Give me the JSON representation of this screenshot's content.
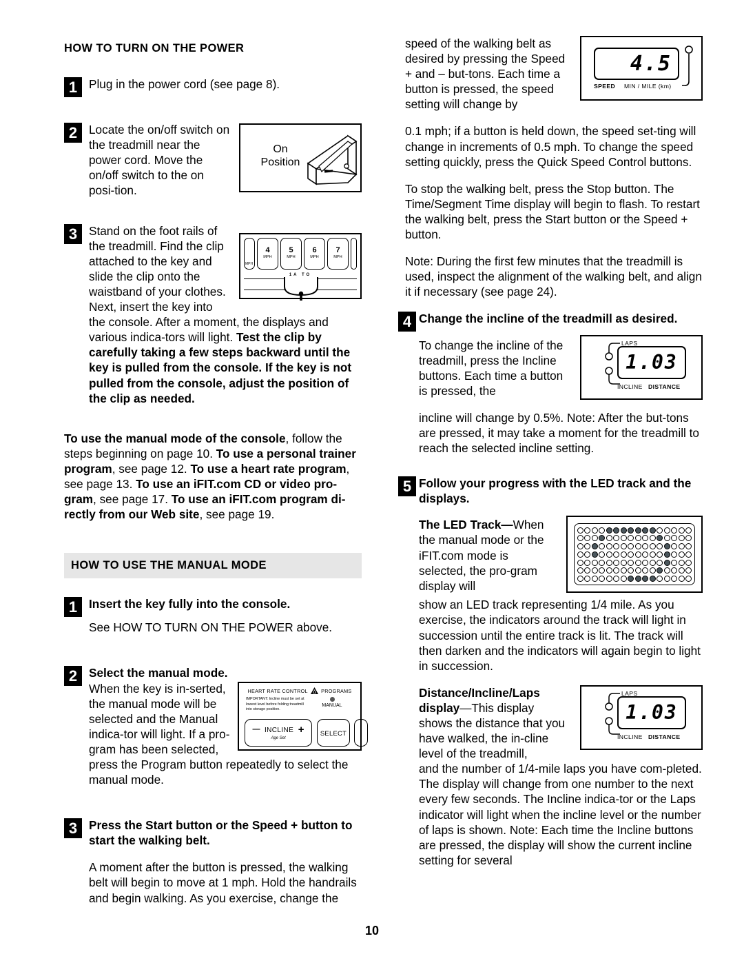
{
  "page": {
    "folio": "10"
  },
  "left": {
    "section1": {
      "heading": "HOW TO TURN ON THE POWER",
      "steps": [
        {
          "num": "1",
          "text": "Plug in the power cord (see page 8)."
        },
        {
          "num": "2",
          "text": "Locate the on/off switch on the treadmill near the power cord. Move the on/off switch to the on posi-tion."
        },
        {
          "num": "3",
          "text_plain": "Stand on the foot rails of the treadmill. Find the clip attached to the key and slide the clip onto the waistband of your clothes. Next, insert the key into the console. After a moment, the displays and various indica-tors will light. ",
          "text_bold": "Test the clip by carefully taking a few steps backward until the key is pulled from the console. If the key is not pulled from the console, adjust the position of the clip as needed."
        }
      ],
      "modes_paragraph": {
        "b1": "To use the manual mode of the console",
        "t1": ", follow the steps beginning on page 10. ",
        "b2": "To use a personal trainer program",
        "t2": ", see page 12. ",
        "b3": "To use a heart rate program",
        "t3": ", see page 13. ",
        "b4": "To use an iFIT.com CD or video pro-gram",
        "t4": ", see page 17. ",
        "b5": "To use an iFIT.com program di-rectly from our Web site",
        "t5": ", see page 19."
      }
    },
    "section2": {
      "heading": "HOW TO USE THE MANUAL MODE",
      "steps": [
        {
          "num": "1",
          "bold": "Insert the key fully into the console.",
          "body": "See HOW TO TURN ON THE POWER above."
        },
        {
          "num": "2",
          "bold": "Select the manual mode.",
          "body": "When the key is in-serted, the manual mode will be selected and the Manual indica-tor will light. If a pro-gram has been selected, press the Program button repeatedly to select the manual mode."
        },
        {
          "num": "3",
          "bold": "Press the Start button or the Speed + button to start the walking belt.",
          "body": "A moment after the button is pressed, the walking belt will begin to move at 1 mph. Hold the handrails and begin walking. As you exercise, change the"
        }
      ]
    },
    "figures": {
      "switch": {
        "label_line1": "On",
        "label_line2": "Position"
      },
      "speed_keys": {
        "keys": [
          {
            "value": "4",
            "unit": "MPH"
          },
          {
            "value": "5",
            "unit": "MPH"
          },
          {
            "value": "6",
            "unit": "MPH"
          },
          {
            "value": "7",
            "unit": "MPH"
          }
        ],
        "marks": "1A  TO"
      },
      "console": {
        "top_label": "HEART RATE CONTROL",
        "top_label2": "PROGRAMS",
        "warning": "IMPORTANT: Incline must be set at lowest level before folding treadmill into storage position.",
        "indicator_label": "MANUAL",
        "incline_minus": "—",
        "incline_label": "INCLINE",
        "incline_plus": "+",
        "incline_sub": "Age Set",
        "select_label": "SELECT"
      }
    }
  },
  "right": {
    "p_speed_wrap": "speed of the walking belt as desired by pressing the Speed + and – but-tons. Each time a button is pressed, the speed setting will change by",
    "p_speed_rest": "0.1 mph; if a button is held down, the speed set-ting will change in increments of 0.5 mph. To change the speed setting quickly, press the Quick Speed Control buttons.",
    "p_stop": "To stop the walking belt, press the Stop button. The Time/Segment Time display will begin to flash. To restart the walking belt, press the Start button or the Speed + button.",
    "p_note": "Note: During the first few minutes that the treadmill is used, inspect the alignment of the walking belt, and align it if necessary (see page 24).",
    "step4": {
      "num": "4",
      "bold": "Change the incline of the treadmill as desired.",
      "body_wrap": "To change the incline of the treadmill, press the Incline buttons. Each time a button is pressed, the",
      "body_rest": "incline will change by 0.5%. Note: After the but-tons are pressed, it may take a moment for the treadmill to reach the selected incline setting."
    },
    "step5": {
      "num": "5",
      "bold": "Follow your progress with the LED track and the displays.",
      "led_track_bold": "The LED Track—",
      "led_track_wrap": "When the manual mode or the iFIT.com mode is selected, the pro-gram display will",
      "led_track_rest": "show an LED track representing 1/4 mile. As you exercise, the indicators around the track will light in succession until the entire track is lit. The track will then darken and the indicators will again begin to light in succession.",
      "dil_bold": "Distance/Incline/Laps display",
      "dil_wrap": "—This display shows the distance that you have walked, the in-cline level of the treadmill,",
      "dil_rest": "and the number of 1/4-mile laps you have com-pleted. The display will change from one number to the next every few seconds. The Incline indica-tor or the Laps indicator will light when the incline level or the number of laps is shown. Note: Each time the Incline buttons are pressed, the display will show the current incline setting for several"
    },
    "figures": {
      "speed_display": {
        "value": "4.5",
        "label_left": "SPEED",
        "label_right": "MIN / MILE (km)"
      },
      "distance_display": {
        "value": "1.03",
        "label_top": "LAPS",
        "label_bottom_left": "INCLINE",
        "label_bottom_right": "DISTANCE"
      },
      "led_track": {
        "rows": 7,
        "cols": 16,
        "lit": [
          [
            0,
            0,
            0,
            0,
            1,
            1,
            1,
            1,
            1,
            1,
            1,
            0,
            0,
            0,
            0,
            0
          ],
          [
            0,
            0,
            0,
            1,
            0,
            0,
            0,
            0,
            0,
            0,
            0,
            1,
            0,
            0,
            0,
            0
          ],
          [
            0,
            0,
            1,
            0,
            0,
            0,
            0,
            0,
            0,
            0,
            0,
            0,
            1,
            0,
            0,
            0
          ],
          [
            0,
            0,
            1,
            0,
            0,
            0,
            0,
            0,
            0,
            0,
            0,
            0,
            1,
            0,
            0,
            0
          ],
          [
            0,
            0,
            0,
            0,
            0,
            0,
            0,
            0,
            0,
            0,
            0,
            0,
            1,
            0,
            0,
            0
          ],
          [
            0,
            0,
            0,
            0,
            0,
            0,
            0,
            0,
            0,
            0,
            0,
            1,
            0,
            0,
            0,
            0
          ],
          [
            0,
            0,
            0,
            0,
            0,
            0,
            0,
            1,
            1,
            1,
            1,
            0,
            0,
            0,
            0,
            0
          ]
        ],
        "lit_color": "#4a565c"
      }
    }
  }
}
